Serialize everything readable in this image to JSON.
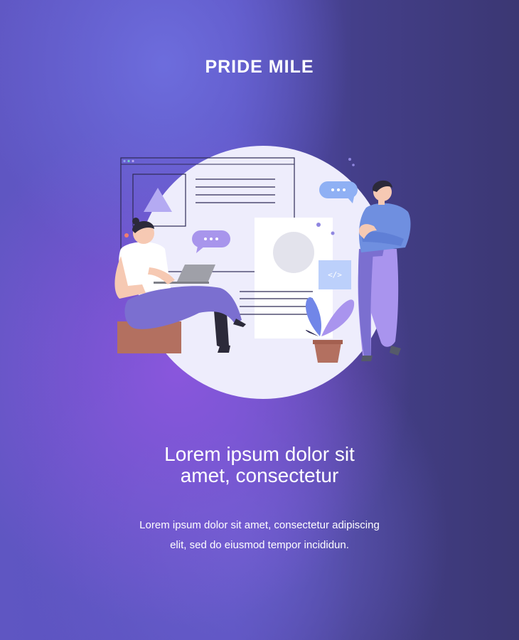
{
  "brand": {
    "name": "PRIDE MILE"
  },
  "hero": {
    "headline_line1": "Lorem ipsum dolor sit",
    "headline_line2": "amet, consectetur",
    "body_line1": "Lorem ipsum dolor sit amet, consectetur adipiscing",
    "body_line2": "elit, sed do eiusmod tempor incididun."
  },
  "illustration": {
    "code_tag": "</>",
    "colors": {
      "circle": "#eeedfc",
      "accent_purple": "#9b8be6",
      "pants": "#7b6fd0",
      "shirt_blue": "#6f8fe0",
      "box": "#b37060"
    }
  }
}
